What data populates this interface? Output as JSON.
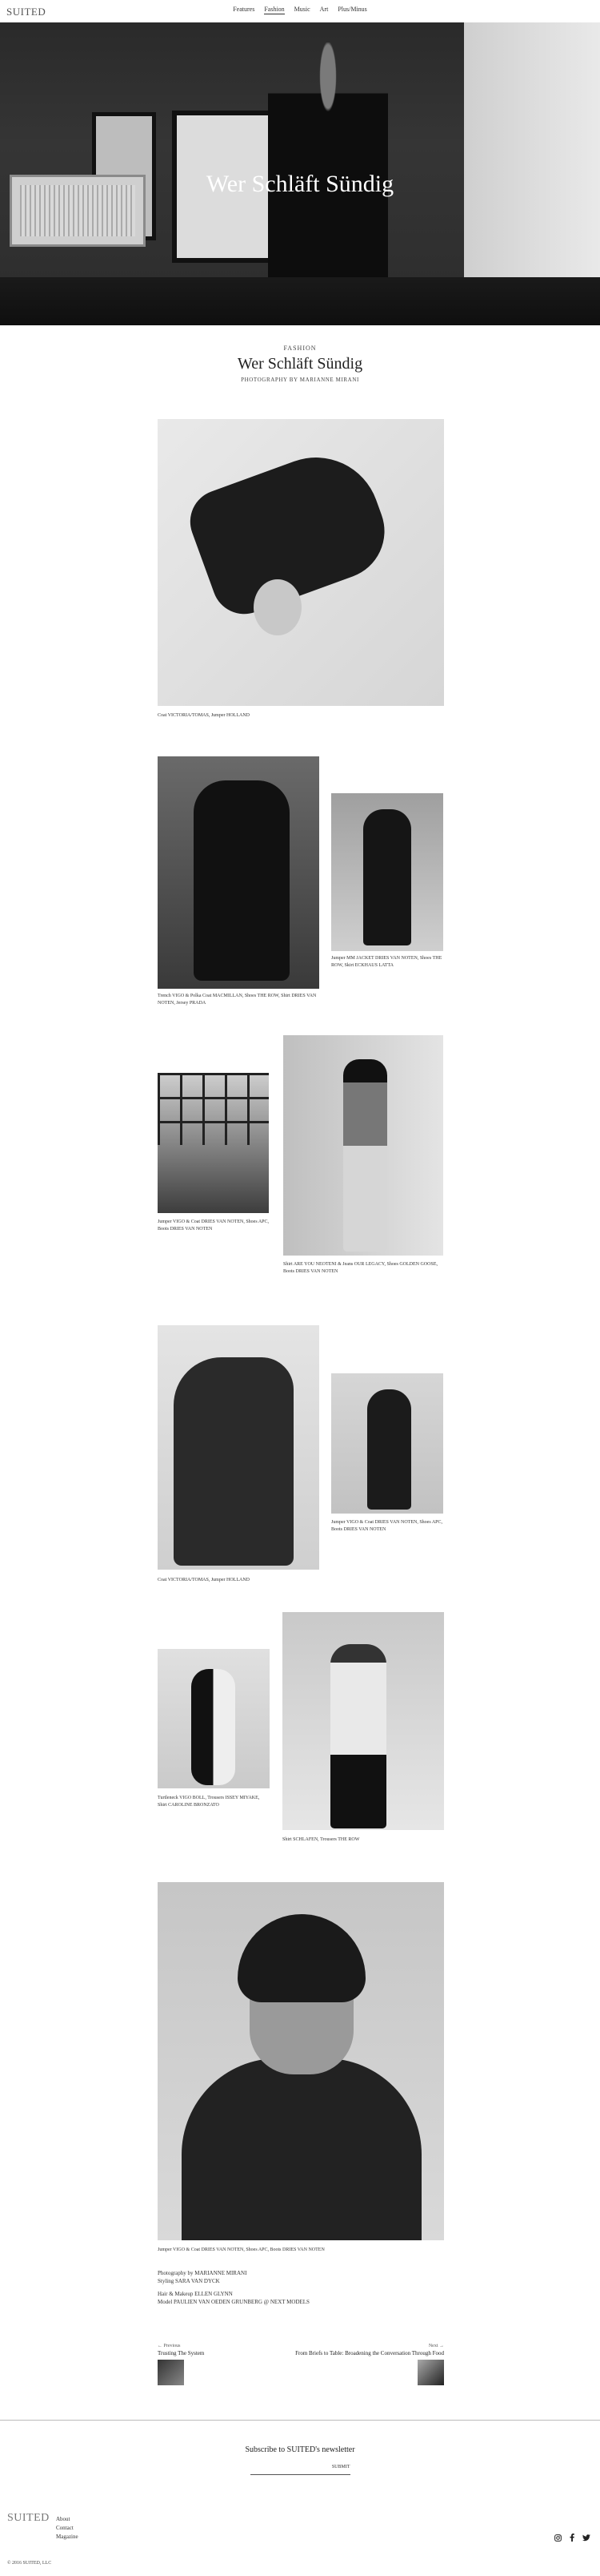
{
  "site": {
    "logo": "SUITED",
    "nav": [
      "Features",
      "Fashion",
      "Music",
      "Art",
      "Plus/Minus"
    ],
    "active_nav": "Fashion"
  },
  "hero": {
    "title": "Wer Schläft Sündig"
  },
  "article": {
    "category": "FASHION",
    "title": "Wer Schläft Sündig",
    "byline": "PHOTOGRAPHY BY MARIANNE MIRANI"
  },
  "captions": {
    "c1": "Coat VICTORIA/TOMAS, Jumper HOLLAND",
    "c2": "Trench VIGO & Polka Coat MACMILLAN, Shoes THE ROW, Shirt DRIES VAN NOTEN, Jersey PRADA",
    "c3": "Jumper MM JACKET DRIES VAN NOTEN, Shoes THE ROW, Skirt ECKHAUS LATTA",
    "c4": "Jumper VIGO & Coat DRIES VAN NOTEN, Shoes APC, Boots DRIES VAN NOTEN",
    "c5": "Shirt ARE YOU NEOTENI & Jeans OUR LEGACY, Shoes GOLDEN GOOSE, Boots DRIES VAN NOTEN",
    "c6": "Coat VICTORIA/TOMAS, Jumper HOLLAND",
    "c7": "Jumper VIGO & Coat DRIES VAN NOTEN, Shoes APC, Boots DRIES VAN NOTEN",
    "c8": "Turtleneck VIGO BOLL, Trousers ISSEY MIYAKE, Shirt CAROLINE BRONZATO",
    "c9": "Shirt SCHLAFEN, Trousers THE ROW",
    "c10": "Jumper VIGO & Coat DRIES VAN NOTEN, Shoes APC, Boots DRIES VAN NOTEN"
  },
  "credits": {
    "photography": "Photography by MARIANNE MIRANI",
    "styling": "Styling SARA VAN DYCK",
    "hair": "Hair & Makeup ELLEN GLYNN",
    "model": "Model PAULIEN VAN OEDEN GRUNBERG @ NEXT MODELS"
  },
  "prevnext": {
    "prev_label": "← Previous",
    "prev_title": "Trusting The System",
    "next_label": "Next →",
    "next_title": "From Briefs to Table: Broadening the Conversation Through Food"
  },
  "newsletter": {
    "title": "Subscribe to SUITED's newsletter",
    "placeholder": "",
    "button": "SUBMIT"
  },
  "footer": {
    "logo": "SUITED",
    "links": [
      "About",
      "Contact",
      "Magazine"
    ],
    "copyright": "© 2016 SUITED, LLC",
    "socials": [
      "instagram-icon",
      "facebook-icon",
      "twitter-icon"
    ]
  }
}
